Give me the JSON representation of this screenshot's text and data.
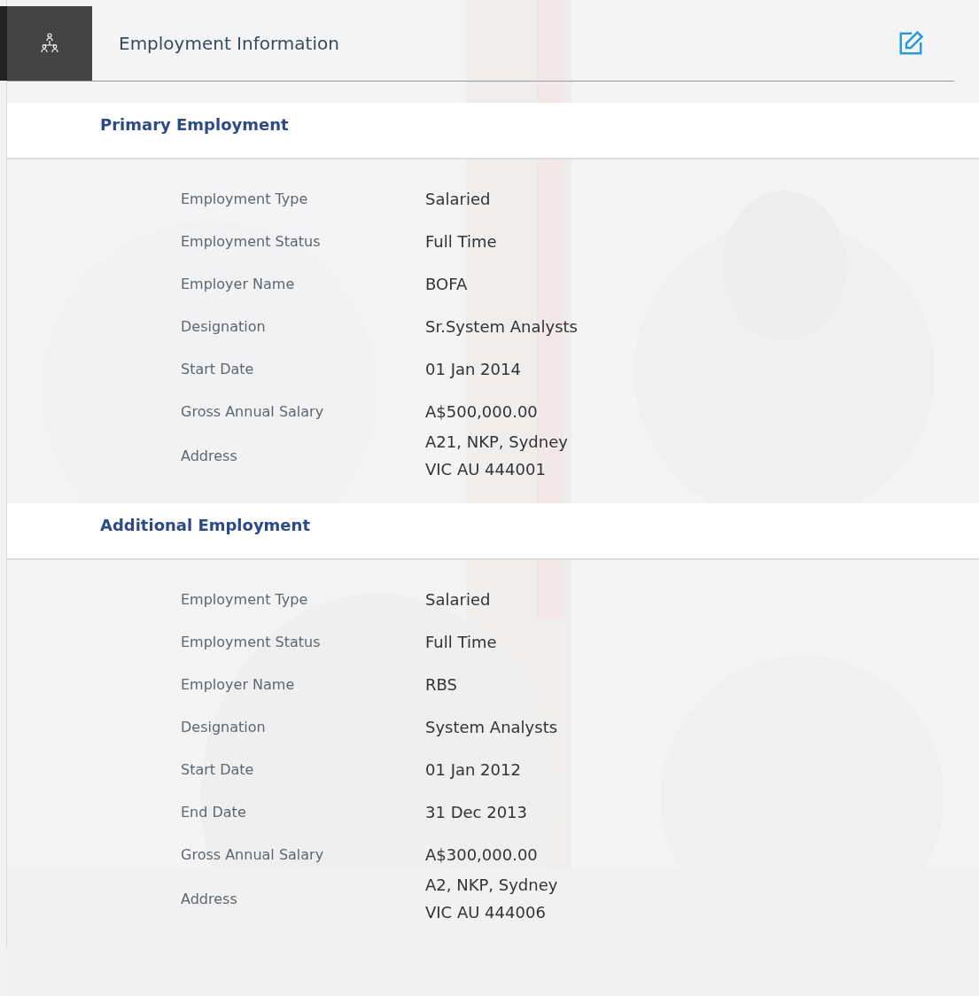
{
  "header": {
    "title": "Employment Information"
  },
  "sections": [
    {
      "title": "Primary Employment",
      "fields": [
        {
          "label": "Employment Type",
          "value": [
            "Salaried"
          ]
        },
        {
          "label": "Employment Status",
          "value": [
            "Full Time"
          ]
        },
        {
          "label": "Employer Name",
          "value": [
            "BOFA"
          ]
        },
        {
          "label": "Designation",
          "value": [
            "Sr.System Analysts"
          ]
        },
        {
          "label": "Start Date",
          "value": [
            "01 Jan 2014"
          ]
        },
        {
          "label": "Gross Annual Salary",
          "value": [
            "A$500,000.00"
          ]
        },
        {
          "label": "Address",
          "value": [
            "A21, NKP, Sydney",
            "VIC AU 444001"
          ]
        }
      ]
    },
    {
      "title": "Additional Employment",
      "fields": [
        {
          "label": "Employment Type",
          "value": [
            "Salaried"
          ]
        },
        {
          "label": "Employment Status",
          "value": [
            "Full Time"
          ]
        },
        {
          "label": "Employer Name",
          "value": [
            "RBS"
          ]
        },
        {
          "label": "Designation",
          "value": [
            "System Analysts"
          ]
        },
        {
          "label": "Start Date",
          "value": [
            "01 Jan 2012"
          ]
        },
        {
          "label": "End Date",
          "value": [
            "31 Dec 2013"
          ]
        },
        {
          "label": "Gross Annual Salary",
          "value": [
            "A$300,000.00"
          ]
        },
        {
          "label": "Address",
          "value": [
            "A2, NKP, Sydney",
            "VIC AU 444006"
          ]
        }
      ]
    }
  ]
}
